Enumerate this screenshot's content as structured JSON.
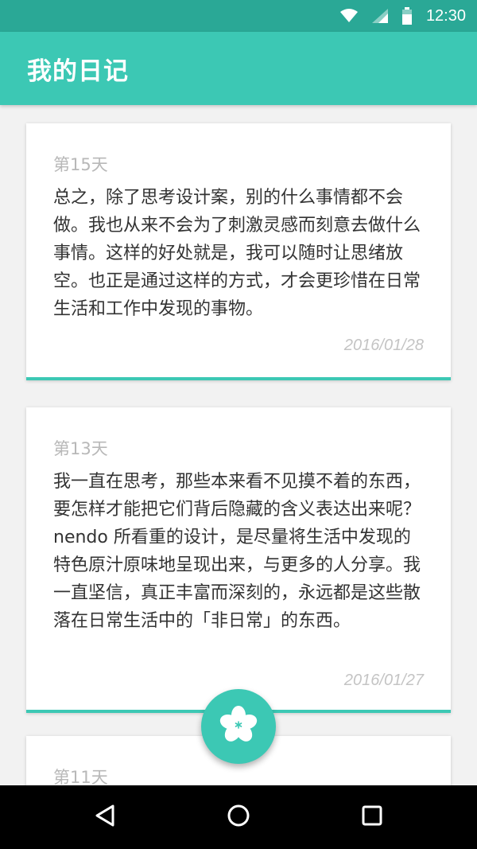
{
  "status_bar": {
    "time": "12:30",
    "icons": [
      "wifi-icon",
      "signal-icon",
      "battery-icon"
    ]
  },
  "app_bar": {
    "title": "我的日记"
  },
  "entries": [
    {
      "day": "第15天",
      "body": "总之，除了思考设计案，别的什么事情都不会做。我也从来不会为了刺激灵感而刻意去做什么事情。这样的好处就是，我可以随时让思绪放空。也正是通过这样的方式，才会更珍惜在日常生活和工作中发现的事物。",
      "date": "2016/01/28"
    },
    {
      "day": "第13天",
      "body": "我一直在思考，那些本来看不见摸不着的东西，要怎样才能把它们背后隐藏的含义表达出来呢？nendo 所看重的设计，是尽量将生活中发现的特色原汁原味地呈现出来，与更多的人分享。我一直坚信，真正丰富而深刻的，永远都是这些散落在日常生活中的「非日常」的东西。",
      "date": "2016/01/27"
    },
    {
      "day": "第11天"
    }
  ],
  "fab": {
    "icon": "flower-icon"
  },
  "nav_bar": {
    "icons": [
      "back-icon",
      "home-icon",
      "recents-icon"
    ]
  },
  "colors": {
    "accent": "#3cc8b4",
    "status_bar": "#2aa896",
    "background": "#f2f2f2",
    "card": "#ffffff",
    "text": "#333333",
    "muted_text": "#b8b8b8"
  }
}
